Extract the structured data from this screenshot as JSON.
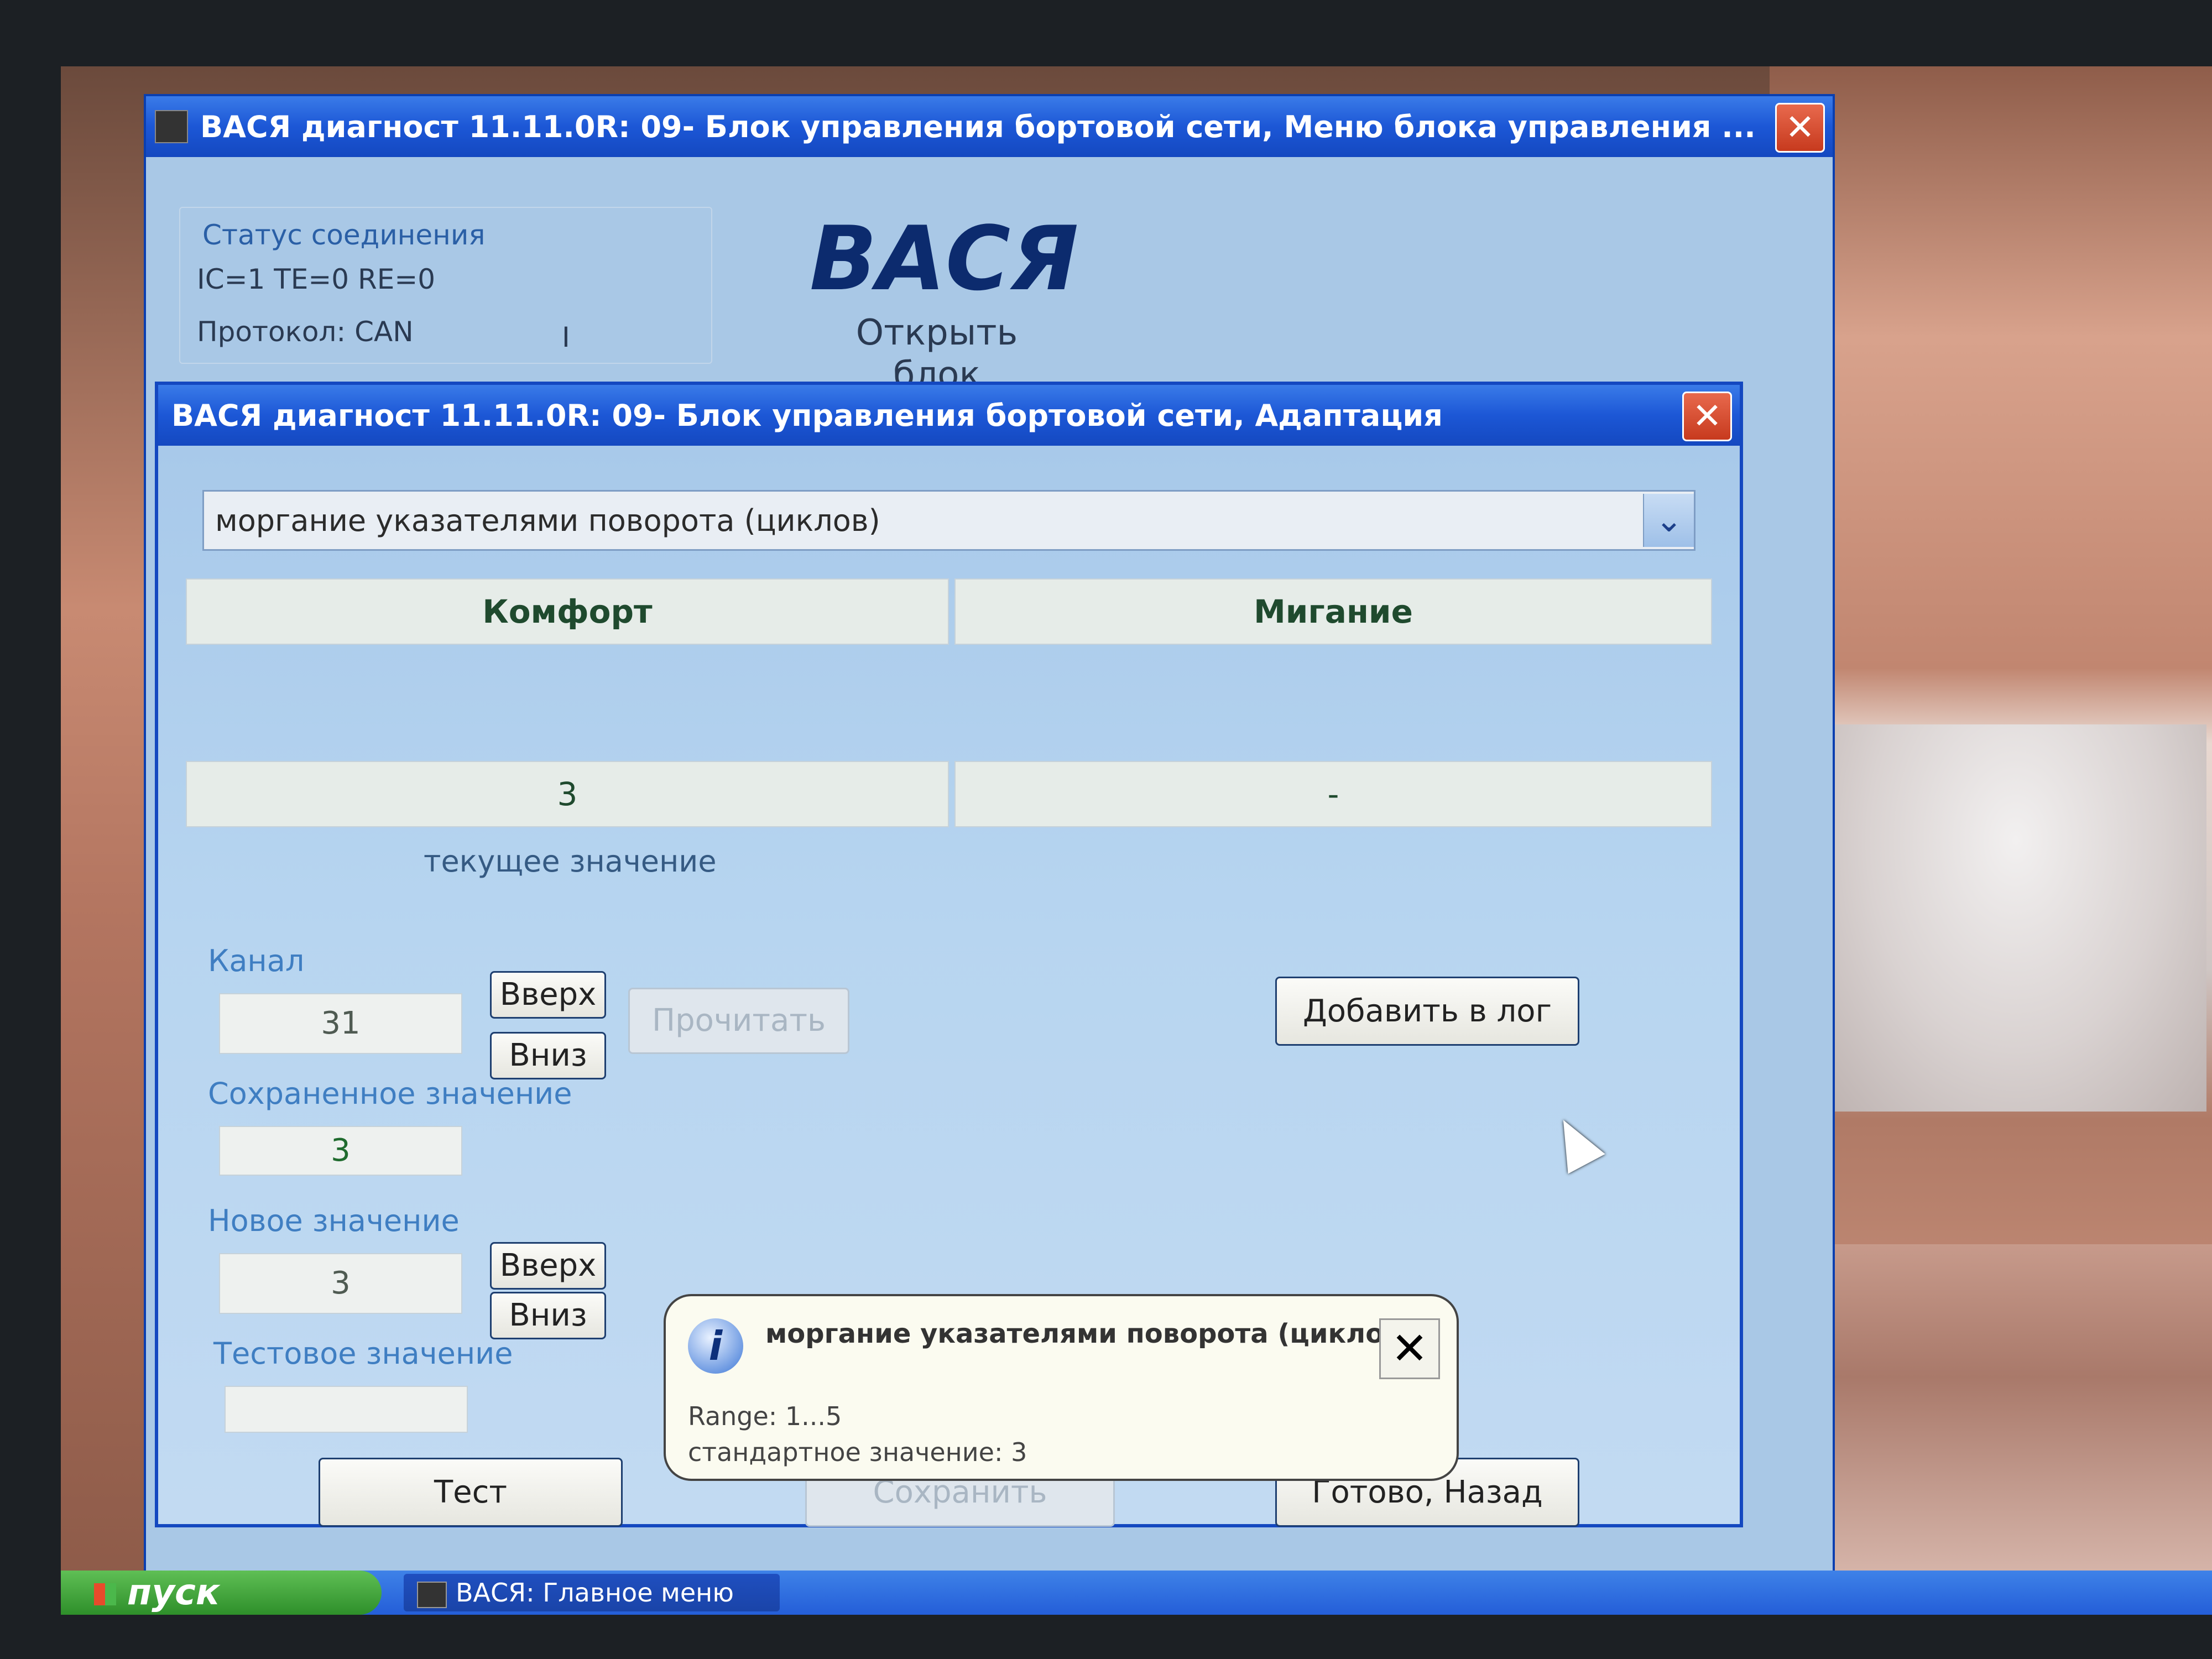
{
  "main_window": {
    "title": "ВАСЯ диагност 11.11.0R: 09- Блок управления бортовой сети,  Меню блока управления ...",
    "close_label": "✕",
    "status": {
      "label": "Статус соединения",
      "line1": "IC=1  TE=0   RE=0",
      "protocol": "Протокол: CAN",
      "cursor_mark": "I"
    },
    "brand": "ВАСЯ",
    "open_unit_label": "Открыть блок управления"
  },
  "dialog": {
    "title": "ВАСЯ диагност 11.11.0R: 09- Блок управления бортовой сети, Адаптация",
    "close_label": "✕",
    "function_select": {
      "value": "моргание указателями поворота (циклов)",
      "arrow": "⌄"
    },
    "columns": [
      {
        "header": "Комфорт",
        "value": "3"
      },
      {
        "header": "Мигание",
        "value": "-"
      }
    ],
    "current_value_caption": "текущее значение",
    "channel": {
      "label": "Канал",
      "value": "31",
      "up_label": "Вверх",
      "down_label": "Вниз",
      "read_label": "Прочитать"
    },
    "saved_value": {
      "label": "Сохраненное значение",
      "value": "3"
    },
    "new_value": {
      "label": "Новое значение",
      "value": "3",
      "up_label": "Вверх",
      "down_label": "Вниз"
    },
    "test_value": {
      "label": "Тестовое значение",
      "value": ""
    },
    "add_to_log_label": "Добавить в лог",
    "test_label": "Тест",
    "save_label": "Сохранить",
    "done_back_label": "Готово, Назад"
  },
  "balloon": {
    "icon": "info-icon",
    "icon_glyph": "i",
    "title": "моргание указателями поворота (циклов)",
    "close_label": "✕",
    "range": "Range: 1...5",
    "standard": "стандартное значение: 3"
  },
  "taskbar": {
    "start_label": "пуск",
    "task_label": "ВАСЯ:  Главное меню"
  },
  "colors": {
    "titlebar": "#1c57d6",
    "window_bg": "#a9c8e6",
    "brand": "#0c2b6e",
    "start_green": "#2e8f2a"
  }
}
